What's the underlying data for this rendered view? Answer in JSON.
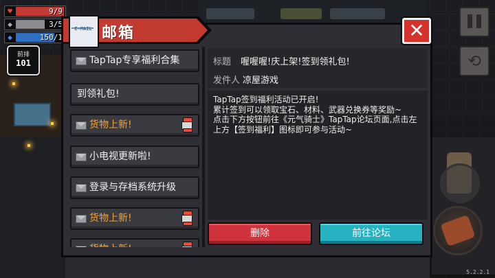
{
  "hud": {
    "hp": "9/9",
    "hp_fill": 1.0,
    "armor": "3/5",
    "armor_fill": 0.6,
    "energy": "150/1",
    "energy_fill": 0.8,
    "rank_label": "前排",
    "rank_value": "101",
    "version": "5.2.2.1"
  },
  "mailbox": {
    "title": "邮箱",
    "icon_text": "E-MAIL",
    "close_label": "✕",
    "items": [
      {
        "label": "TapTap专享福利合集",
        "highlighted": false,
        "gift": false
      },
      {
        "label": "到领礼包!",
        "highlighted": false,
        "gift": false
      },
      {
        "label": "货物上新!",
        "highlighted": true,
        "gift": true
      },
      {
        "label": "小电视更新啦!",
        "highlighted": false,
        "gift": false
      },
      {
        "label": "登录与存档系统升级",
        "highlighted": false,
        "gift": false
      },
      {
        "label": "货物上新!",
        "highlighted": true,
        "gift": true
      },
      {
        "label": "货物上新!",
        "highlighted": true,
        "gift": true
      }
    ]
  },
  "detail": {
    "title_key": "标题",
    "title_value": "喔喔喔!庆上架!签到领礼包!",
    "sender_key": "发件人",
    "sender_value": "凉屋游戏",
    "body": [
      "TapTap签到福利活动已开启!",
      "累计签到可以领取宝石、材料、武器兑换券等奖励~",
      "点击下方按钮前往《元气骑士》TapTap论坛页面,点击左上方【签到福利】图标即可参与活动~"
    ],
    "delete_label": "删除",
    "forum_label": "前往论坛"
  }
}
